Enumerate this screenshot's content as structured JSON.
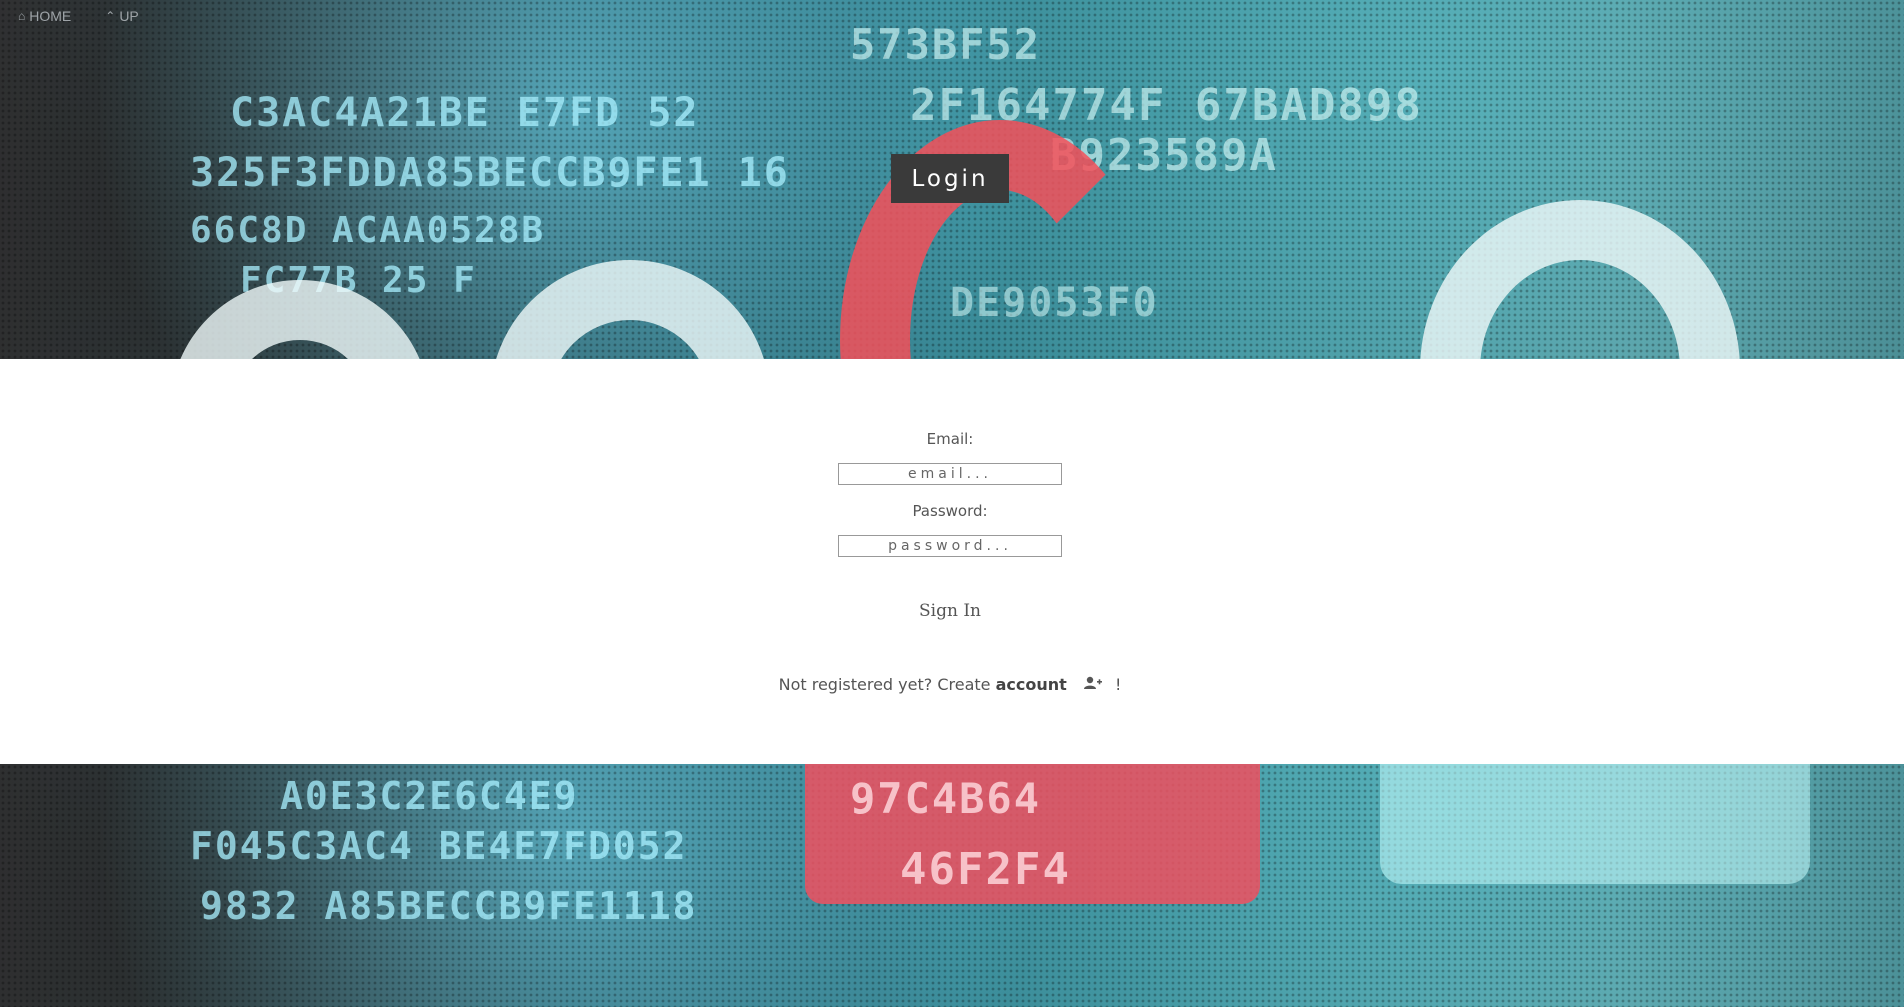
{
  "nav": {
    "home_label": "HOME",
    "up_label": "UP",
    "home_icon": "home-icon",
    "up_icon": "chevron-up-icon"
  },
  "header": {
    "title": "Login"
  },
  "form": {
    "email_label": "Email:",
    "email_placeholder": "email...",
    "email_value": "",
    "password_label": "Password:",
    "password_placeholder": "password...",
    "password_value": "",
    "signin_label": "Sign In"
  },
  "register": {
    "prefix": "Not registered yet? Create",
    "link_label": "account",
    "icon": "user-plus-icon",
    "suffix": "!"
  },
  "colors": {
    "title_bg": "#3a3a3a",
    "accent_red": "#f0505f",
    "accent_teal": "#3d8b96"
  }
}
